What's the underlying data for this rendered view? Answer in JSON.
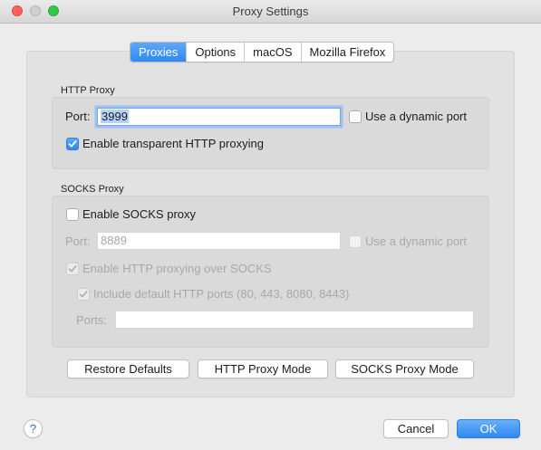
{
  "window": {
    "title": "Proxy Settings"
  },
  "tabs": [
    {
      "label": "Proxies",
      "active": true
    },
    {
      "label": "Options",
      "active": false
    },
    {
      "label": "macOS",
      "active": false
    },
    {
      "label": "Mozilla Firefox",
      "active": false
    }
  ],
  "http_proxy": {
    "section_label": "HTTP Proxy",
    "port_label": "Port:",
    "port_value": "3999",
    "dynamic_port_label": "Use a dynamic port",
    "dynamic_port_checked": false,
    "transparent_label": "Enable transparent HTTP proxying",
    "transparent_checked": true
  },
  "socks_proxy": {
    "section_label": "SOCKS Proxy",
    "enable_label": "Enable SOCKS proxy",
    "enable_checked": false,
    "port_label": "Port:",
    "port_placeholder": "8889",
    "dynamic_port_label": "Use a dynamic port",
    "http_over_socks_label": "Enable HTTP proxying over SOCKS",
    "http_over_socks_checked": true,
    "include_default_ports_label": "Include default HTTP ports (80, 443, 8080, 8443)",
    "include_default_ports_checked": true,
    "ports_label": "Ports:",
    "ports_value": ""
  },
  "buttons": {
    "restore_defaults": "Restore Defaults",
    "http_proxy_mode": "HTTP Proxy Mode",
    "socks_proxy_mode": "SOCKS Proxy Mode",
    "cancel": "Cancel",
    "ok": "OK",
    "help": "?"
  },
  "colors": {
    "accent": "#2f88f2",
    "window_bg": "#ececec"
  }
}
